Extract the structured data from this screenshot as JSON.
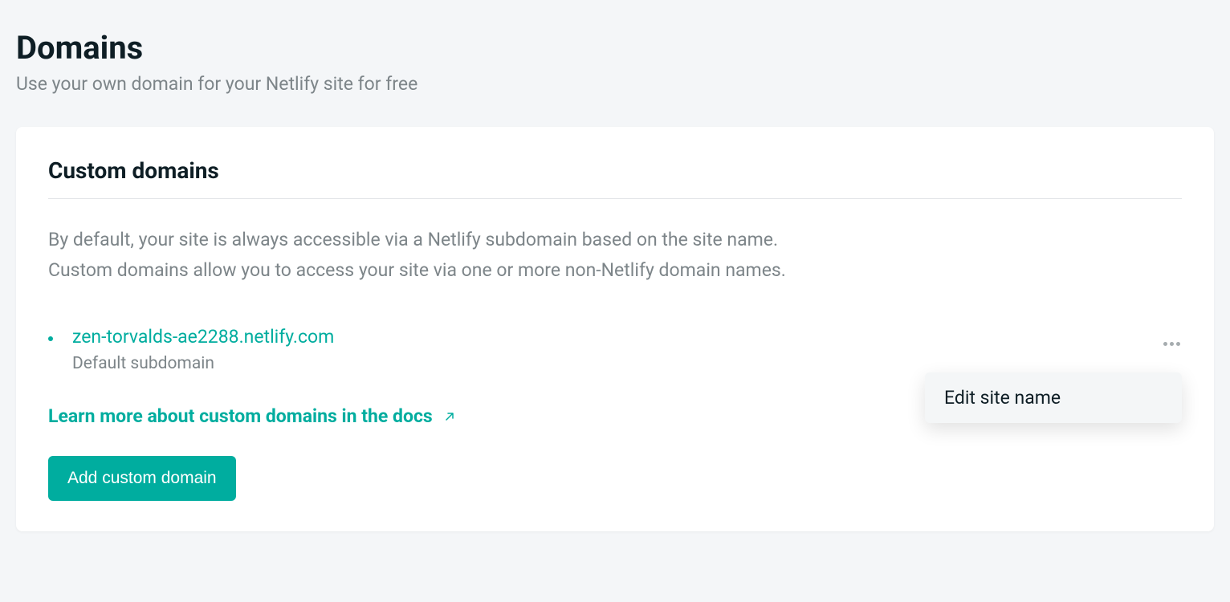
{
  "header": {
    "title": "Domains",
    "subtitle": "Use your own domain for your Netlify site for free"
  },
  "card": {
    "title": "Custom domains",
    "description_line1": "By default, your site is always accessible via a Netlify subdomain based on the site name.",
    "description_line2": "Custom domains allow you to access your site via one or more non-Netlify domain names.",
    "domain": {
      "url": "zen-torvalds-ae2288.netlify.com",
      "label": "Default subdomain"
    },
    "dropdown": {
      "edit_label": "Edit site name"
    },
    "learn_link": "Learn more about custom domains in the docs",
    "add_button": "Add custom domain"
  },
  "colors": {
    "accent": "#00ad9f",
    "text_primary": "#0e1e25",
    "text_secondary": "#7d8589",
    "background": "#f4f6f8"
  }
}
